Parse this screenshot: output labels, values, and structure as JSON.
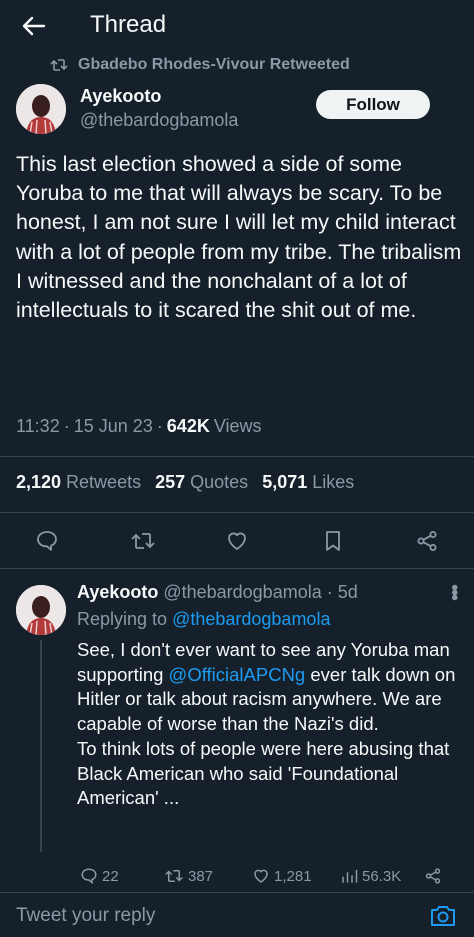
{
  "colors": {
    "background": "#15202b",
    "text_primary": "#f7f9f9",
    "text_secondary": "#8b98a5",
    "accent": "#1d9bf0",
    "divider": "#38444d",
    "follow_button_bg": "#eff3f4"
  },
  "header": {
    "back_icon": "arrow-left-icon",
    "title": "Thread"
  },
  "retweet_context": {
    "icon": "retweet-icon",
    "text": "Gbadebo Rhodes-Vivour Retweeted"
  },
  "main_tweet": {
    "author_name": "Ayekooto",
    "author_handle": "@thebardogbamola",
    "follow_label": "Follow",
    "text": "This last election showed a side of some Yoruba to me that will always be scary. To be honest, I am not sure I will let my child interact with a lot of people from my tribe. The tribalism I witnessed and the nonchalant of a lot of intellectuals to it scared the shit out of me.",
    "time": "11:32",
    "date": "15 Jun 23",
    "views_count": "642K",
    "views_label": "Views",
    "retweets_count": "2,120",
    "retweets_label": "Retweets",
    "quotes_count": "257",
    "quotes_label": "Quotes",
    "likes_count": "5,071",
    "likes_label": "Likes",
    "actions": [
      "reply-icon",
      "retweet-icon",
      "like-icon",
      "bookmark-icon",
      "share-icon"
    ]
  },
  "reply_tweet": {
    "author_name": "Ayekooto",
    "author_handle": "@thebardogbamola",
    "age": "5d",
    "replying_to_label": "Replying to",
    "replying_to_handle": "@thebardogbamola",
    "text_part1": "See, I don't ever want to see any Yoruba man supporting ",
    "mention": "@OfficialAPCNg",
    "text_part2": " ever talk down on Hitler or talk about racism anywhere. We are capable of worse than the Nazi's did.",
    "text_part3": "To think lots of people were here abusing that Black American who said 'Foundational American' ...",
    "reply_count": "22",
    "retweet_count": "387",
    "like_count": "1,281",
    "view_count": "56.3K"
  },
  "reply_bar": {
    "placeholder": "Tweet your reply",
    "camera_icon": "camera-icon"
  }
}
